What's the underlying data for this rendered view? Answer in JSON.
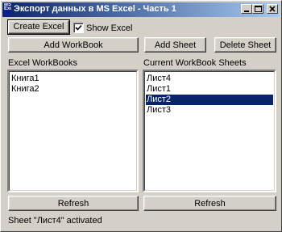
{
  "window": {
    "title": "Экспорт данных в MS Excel - Часть 1",
    "icon_text": "MS Excel"
  },
  "toolbar": {
    "create_excel": "Create Excel",
    "show_excel_label": "Show Excel",
    "show_excel_checked": true,
    "add_workbook": "Add WorkBook",
    "add_sheet": "Add Sheet",
    "delete_sheet": "Delete Sheet"
  },
  "workbooks": {
    "label": "Excel WorkBooks",
    "items": [
      "Книга1",
      "Книга2"
    ],
    "refresh": "Refresh"
  },
  "sheets": {
    "label": "Current WorkBook Sheets",
    "items": [
      "Лист4",
      "Лист1",
      "Лист2",
      "Лист3"
    ],
    "selected": "Лист2",
    "refresh": "Refresh"
  },
  "status": "Sheet \"Лист4\" activated",
  "colors": {
    "title_start": "#0a246a",
    "title_end": "#a6caf0",
    "selection": "#0a246a",
    "face": "#d4d0c8"
  }
}
